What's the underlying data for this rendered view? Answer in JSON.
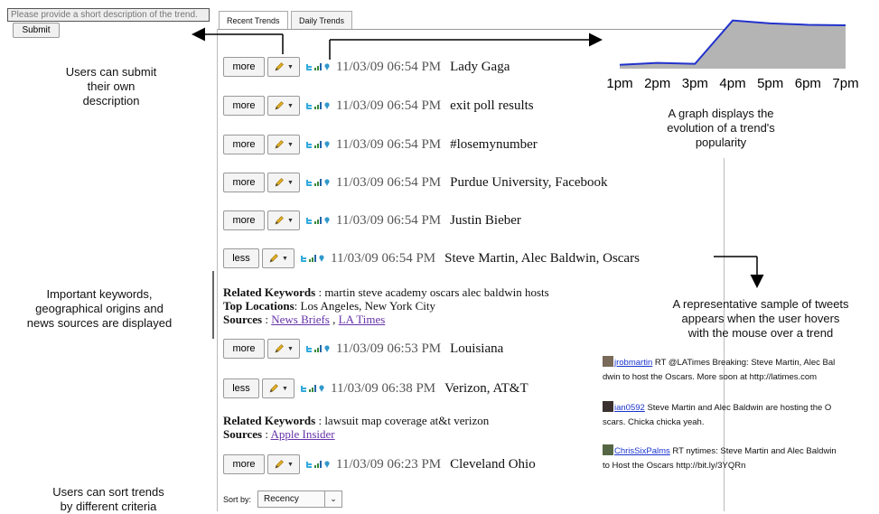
{
  "description_form": {
    "placeholder": "Please provide a short description of the trend.",
    "submit_label": "Submit"
  },
  "tabs": [
    {
      "label": "Recent Trends",
      "active": true
    },
    {
      "label": "Daily Trends",
      "active": false
    }
  ],
  "annotations": {
    "submit_note": "Users can submit\ntheir own\ndescription",
    "graph_note": "A graph displays the\nevolution of a trend's\npopularity",
    "keywords_note": "Important keywords,\ngeographical origins and\nnews sources are displayed",
    "tweets_note": "A representative sample of tweets\nappears when the user hovers\nwith the mouse over a trend",
    "sort_note": "Users can sort trends\nby different criteria"
  },
  "trends": [
    {
      "button": "more",
      "time": "11/03/09 06:54 PM",
      "topic": "Lady Gaga"
    },
    {
      "button": "more",
      "time": "11/03/09 06:54 PM",
      "topic": "exit poll results"
    },
    {
      "button": "more",
      "time": "11/03/09 06:54 PM",
      "topic": "#losemynumber"
    },
    {
      "button": "more",
      "time": "11/03/09 06:54 PM",
      "topic": "Purdue University, Facebook"
    },
    {
      "button": "more",
      "time": "11/03/09 06:54 PM",
      "topic": "Justin Bieber"
    },
    {
      "button": "less",
      "time": "11/03/09 06:54 PM",
      "topic": "Steve Martin, Alec Baldwin, Oscars"
    },
    {
      "button": "more",
      "time": "11/03/09 06:53 PM",
      "topic": "Louisiana"
    },
    {
      "button": "less",
      "time": "11/03/09 06:38 PM",
      "topic": "Verizon, AT&T"
    },
    {
      "button": "more",
      "time": "11/03/09 06:23 PM",
      "topic": "Cleveland Ohio"
    }
  ],
  "details": [
    {
      "keywords_label": "Related Keywords",
      "keywords": "martin steve academy oscars alec baldwin hosts",
      "locations_label": "Top Locations",
      "locations": "Los Angeles, New York City",
      "sources_label": "Sources",
      "sources": [
        "News Briefs",
        "LA Times"
      ]
    },
    {
      "keywords_label": "Related Keywords",
      "keywords": "lawsuit map coverage at&t verizon",
      "sources_label": "Sources",
      "sources": [
        "Apple Insider"
      ]
    }
  ],
  "tweets": [
    {
      "user": "jrobmartin",
      "text": " RT @LATimes Breaking: Steve Martin, Alec Bal",
      "text2": "dwin to host the Oscars. More soon at http://latimes.com"
    },
    {
      "user": "ian0592",
      "text": " Steve Martin and Alec Baldwin are hosting the O",
      "text2": "scars. Chicka chicka yeah."
    },
    {
      "user": "ChrisSixPalms",
      "text": " RT nytimes: Steve Martin and Alec Baldwin",
      "text2": "to Host the Oscars http://bit.ly/3YQRn"
    }
  ],
  "sort": {
    "label": "Sort by:",
    "value": "Recency"
  },
  "chart_data": {
    "type": "area",
    "categories": [
      "1pm",
      "2pm",
      "3pm",
      "4pm",
      "5pm",
      "6pm",
      "7pm"
    ],
    "values": [
      0.08,
      0.12,
      0.1,
      1.0,
      0.94,
      0.91,
      0.9
    ],
    "ylim": [
      0,
      1.05
    ],
    "grid": false,
    "line_color": "#2233cc",
    "fill_color": "#b4b4b4",
    "title": "",
    "xlabel": "",
    "ylabel": ""
  }
}
